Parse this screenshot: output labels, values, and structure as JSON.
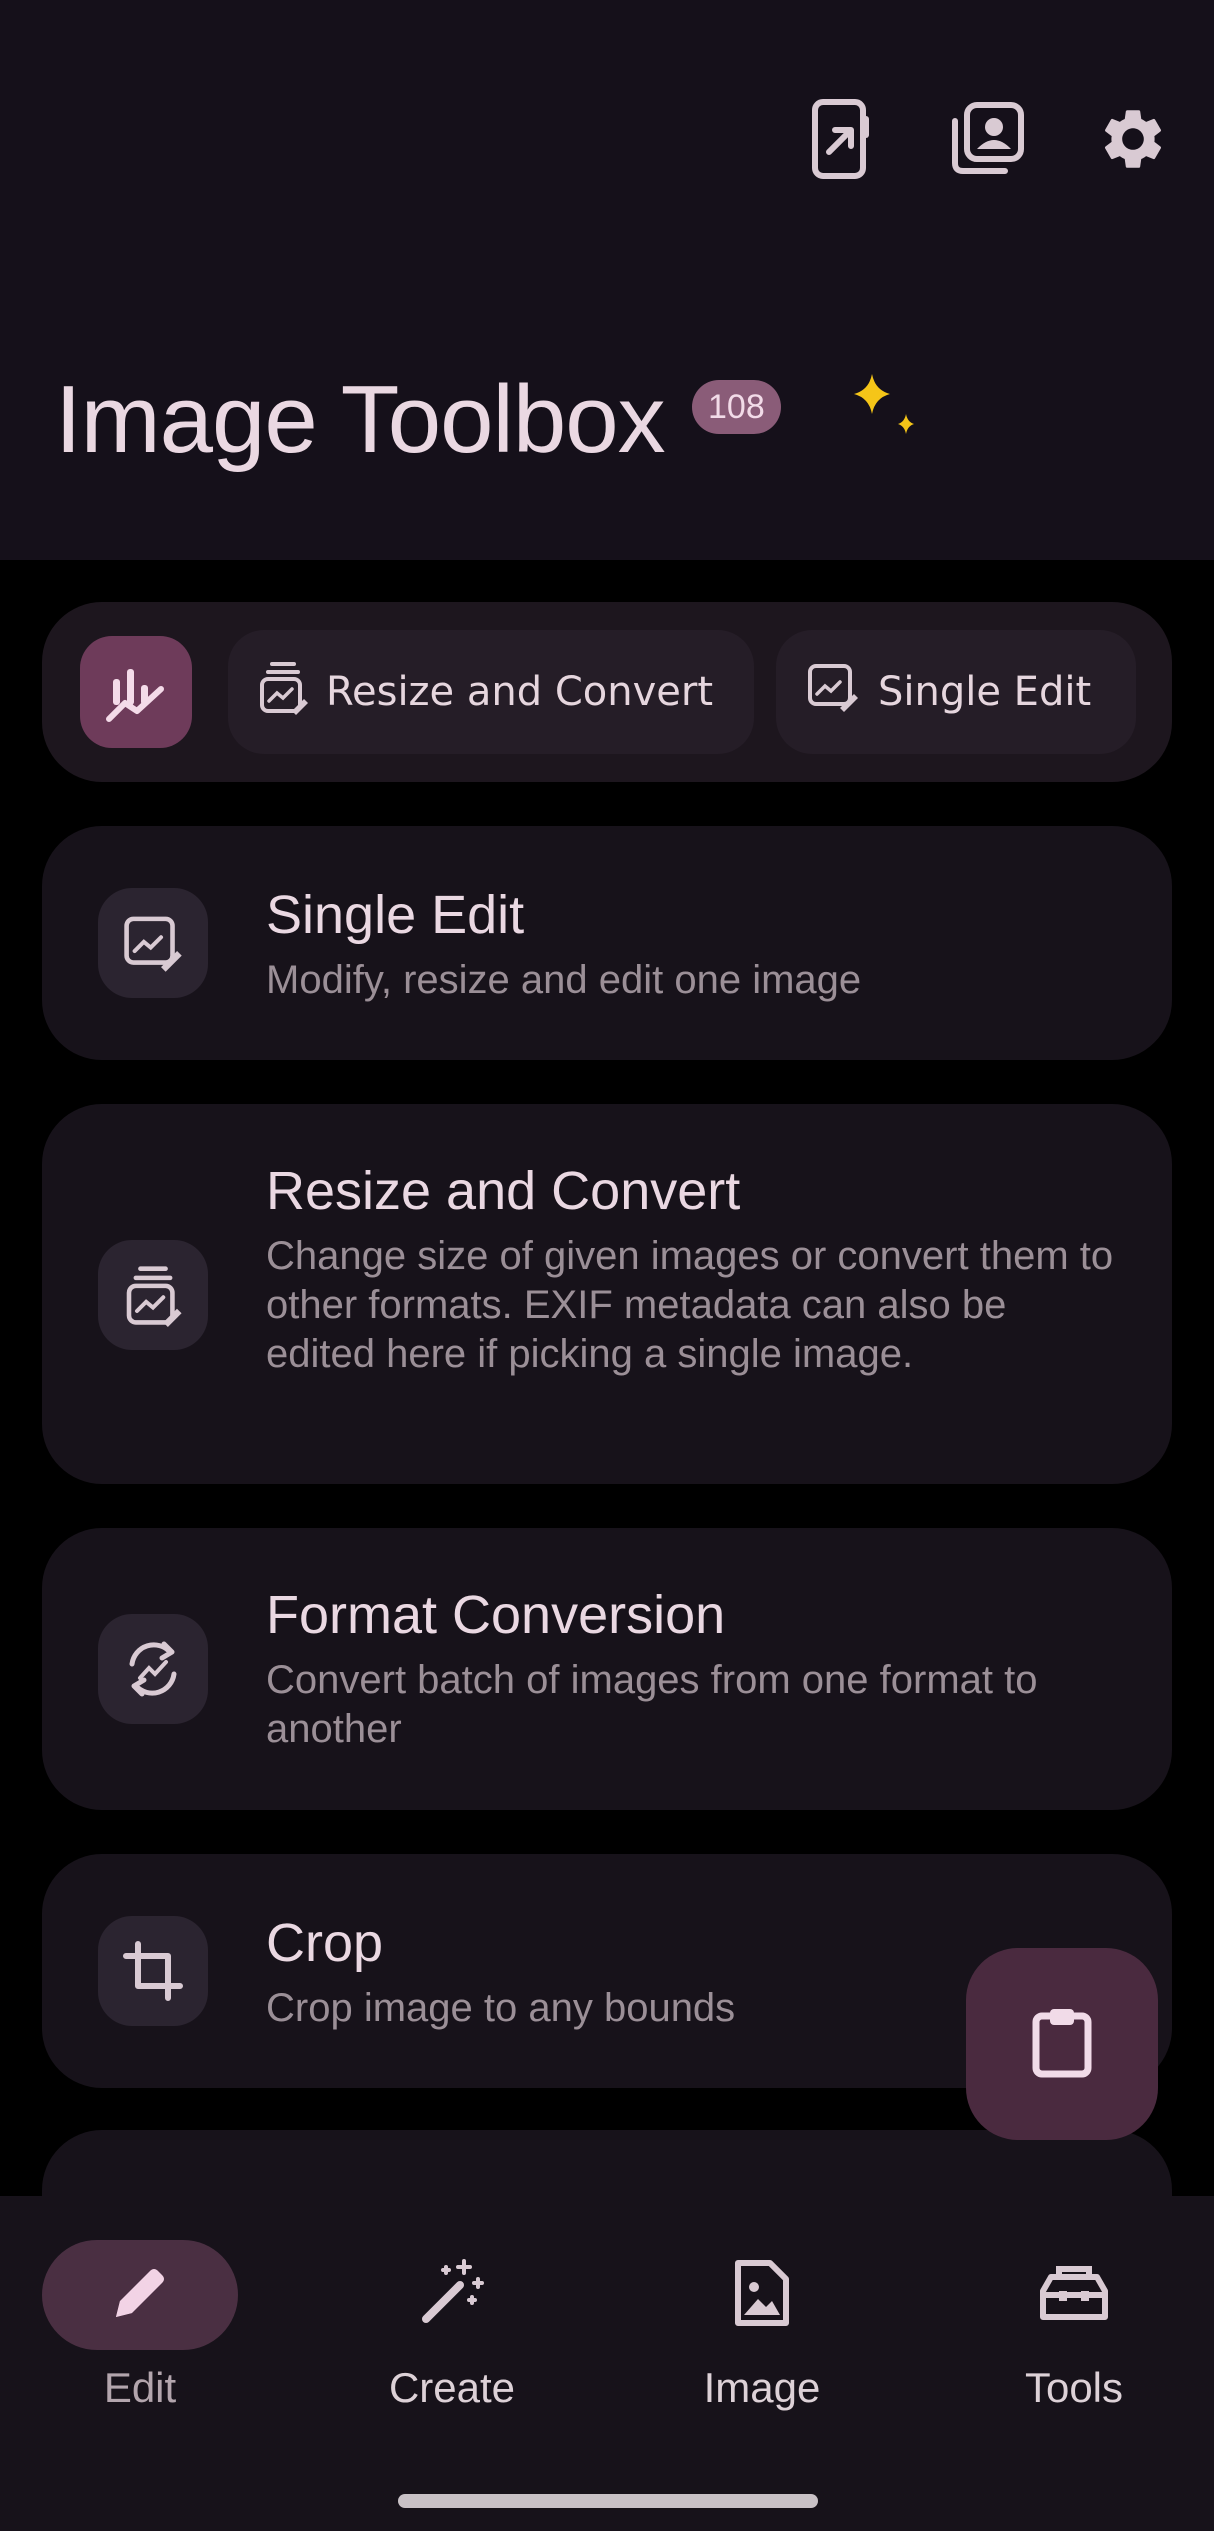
{
  "app": {
    "title": "Image Toolbox",
    "version_badge": "108"
  },
  "header_actions": [
    {
      "icon": "open-in-app-icon"
    },
    {
      "icon": "image-gallery-icon"
    },
    {
      "icon": "settings-gear-icon"
    }
  ],
  "favorites": {
    "main_icon": "chart-sparkle-icon",
    "chips": [
      {
        "label": "Resize and Convert",
        "icon": "resize-convert-icon"
      },
      {
        "label": "Single Edit",
        "icon": "single-edit-icon"
      }
    ]
  },
  "tools": [
    {
      "title": "Single Edit",
      "description": "Modify, resize and edit one image",
      "icon": "single-edit-icon"
    },
    {
      "title": "Resize and Convert",
      "description": "Change size of given images or convert them to other formats. EXIF metadata can also be edited here if picking a single image.",
      "icon": "resize-convert-icon"
    },
    {
      "title": "Format Conversion",
      "description": "Convert batch of images from one format to another",
      "icon": "format-convert-icon"
    },
    {
      "title": "Crop",
      "description": "Crop image to any bounds",
      "icon": "crop-icon"
    }
  ],
  "fab": {
    "icon": "clipboard-icon"
  },
  "bottom_nav": [
    {
      "label": "Edit",
      "icon": "pencil-icon",
      "active": true
    },
    {
      "label": "Create",
      "icon": "magic-wand-icon",
      "active": false
    },
    {
      "label": "Image",
      "icon": "image-file-icon",
      "active": false
    },
    {
      "label": "Tools",
      "icon": "toolbox-icon",
      "active": false
    }
  ],
  "colors": {
    "background": "#000000",
    "surface": "#15101a",
    "accent": "#6e3b5a",
    "badge": "#8a5c78",
    "sparkle": "#f5c518"
  }
}
